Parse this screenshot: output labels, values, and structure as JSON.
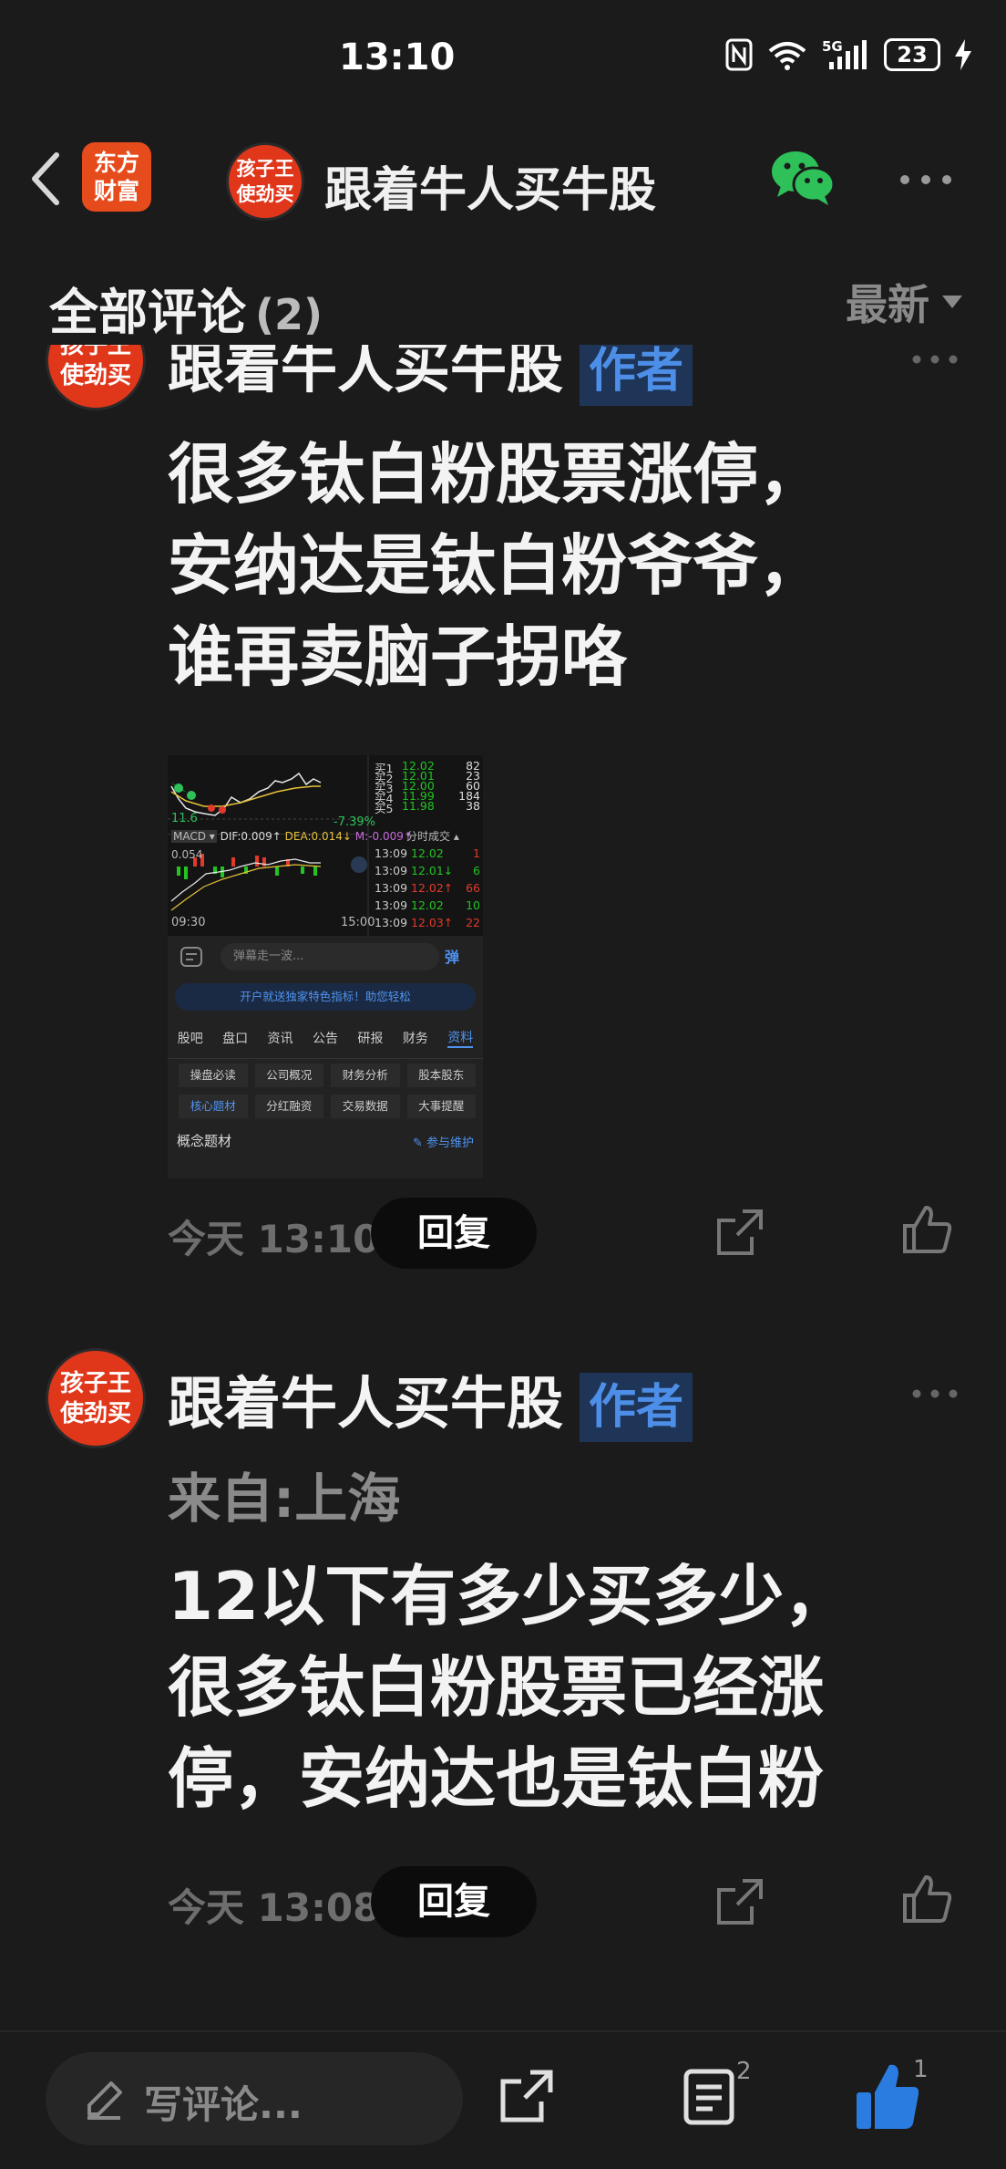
{
  "status_bar": {
    "time": "13:10",
    "network": "5G",
    "battery": "23"
  },
  "nav": {
    "app_logo_text": [
      "东方",
      "财富"
    ],
    "avatar_text": [
      "孩子王",
      "使劲买"
    ],
    "title": "跟着牛人买牛股"
  },
  "comments_header": {
    "title": "全部评论",
    "count": "(2)",
    "sort_label": "最新"
  },
  "comments": [
    {
      "author": "跟着牛人买牛股",
      "badge": "作者",
      "avatar_text": [
        "孩子王",
        "使劲买"
      ],
      "lines": [
        "很多钛白粉股票涨停，",
        "安纳达是钛白粉爷爷，",
        "谁再卖脑子拐咯"
      ],
      "time": "今天 13:10",
      "reply_label": "回复",
      "image": {
        "price_label": "11.6",
        "change": "-7.39%",
        "macd_row": [
          "MACD ▾",
          "DIF:0.009↑",
          "DEA:0.014↓",
          "M:-0.009↑"
        ],
        "macd_scale": "0.054",
        "time_start": "09:30",
        "time_end": "15:00",
        "order_book": [
          {
            "label": "买1",
            "price": "12.02",
            "vol": "82"
          },
          {
            "label": "买2",
            "price": "12.01",
            "vol": "23"
          },
          {
            "label": "买3",
            "price": "12.00",
            "vol": "60"
          },
          {
            "label": "买4",
            "price": "11.99",
            "vol": "184"
          },
          {
            "label": "买5",
            "price": "11.98",
            "vol": "38"
          }
        ],
        "ticks_title": "分时成交 ▴",
        "ticks": [
          {
            "time": "13:09",
            "price": "12.02",
            "vol": "1"
          },
          {
            "time": "13:09",
            "price": "12.01↓",
            "vol": "6"
          },
          {
            "time": "13:09",
            "price": "12.02↑",
            "vol": "66"
          },
          {
            "time": "13:09",
            "price": "12.02",
            "vol": "10"
          },
          {
            "time": "13:09",
            "price": "12.03↑",
            "vol": "22"
          }
        ],
        "input_placeholder": "弹幕走一波...",
        "banner": "开户就送独家特色指标！助您轻松",
        "tabs": [
          "股吧",
          "盘口",
          "资讯",
          "公告",
          "研报",
          "财务",
          "资料"
        ],
        "grid": [
          "操盘必读",
          "公司概况",
          "财务分析",
          "股本股东",
          "核心题材",
          "分红融资",
          "交易数据",
          "大事提醒"
        ],
        "concept_title": "概念题材",
        "maintain_link": "参与维护"
      }
    },
    {
      "author": "跟着牛人买牛股",
      "badge": "作者",
      "avatar_text": [
        "孩子王",
        "使劲买"
      ],
      "location": "来自:上海",
      "lines": [
        "12以下有多少买多少，",
        "很多钛白粉股票已经涨",
        "停，安纳达也是钛白粉"
      ],
      "time": "今天 13:08",
      "reply_label": "回复"
    }
  ],
  "bottom_bar": {
    "write_placeholder": "写评论...",
    "comment_count": "2",
    "like_count": "1"
  },
  "colors": {
    "accent_blue": "#2a7ce0",
    "brand_orange": "#e64b1c",
    "background": "#1b1b1b",
    "price_up": "#e23a2a",
    "price_green": "#22c322"
  }
}
